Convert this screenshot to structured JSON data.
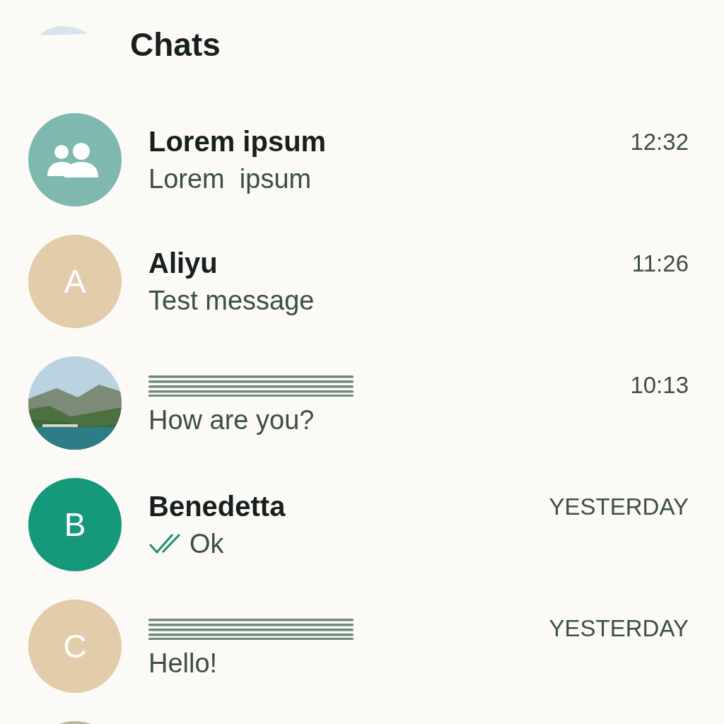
{
  "header": {
    "title": "Chats"
  },
  "chats": [
    {
      "avatar": {
        "kind": "group",
        "color": "#7fb8ae"
      },
      "name": "Lorem ipsum",
      "message": "Lorem  ipsum",
      "time": "12:32",
      "read_ticks": false
    },
    {
      "avatar": {
        "kind": "letter",
        "letter": "A",
        "color": "#e2ccaa"
      },
      "name": "Aliyu",
      "message": "Test message",
      "time": "11:26",
      "read_ticks": false
    },
    {
      "name_redacted": true,
      "message": "How are you?",
      "time": "10:13",
      "read_ticks": false
    },
    {
      "avatar": {
        "kind": "letter",
        "letter": "B",
        "color": "#16987a"
      },
      "name": "Benedetta",
      "message": "Ok",
      "time": "YESTERDAY",
      "read_ticks": true
    },
    {
      "avatar": {
        "kind": "letter",
        "letter": "C",
        "color": "#e2ccaa"
      },
      "name_redacted": true,
      "message": "Hello!",
      "time": "YESTERDAY",
      "read_ticks": false
    },
    {
      "avatar": {
        "kind": "plain",
        "color": "#b9b7a4"
      }
    }
  ]
}
